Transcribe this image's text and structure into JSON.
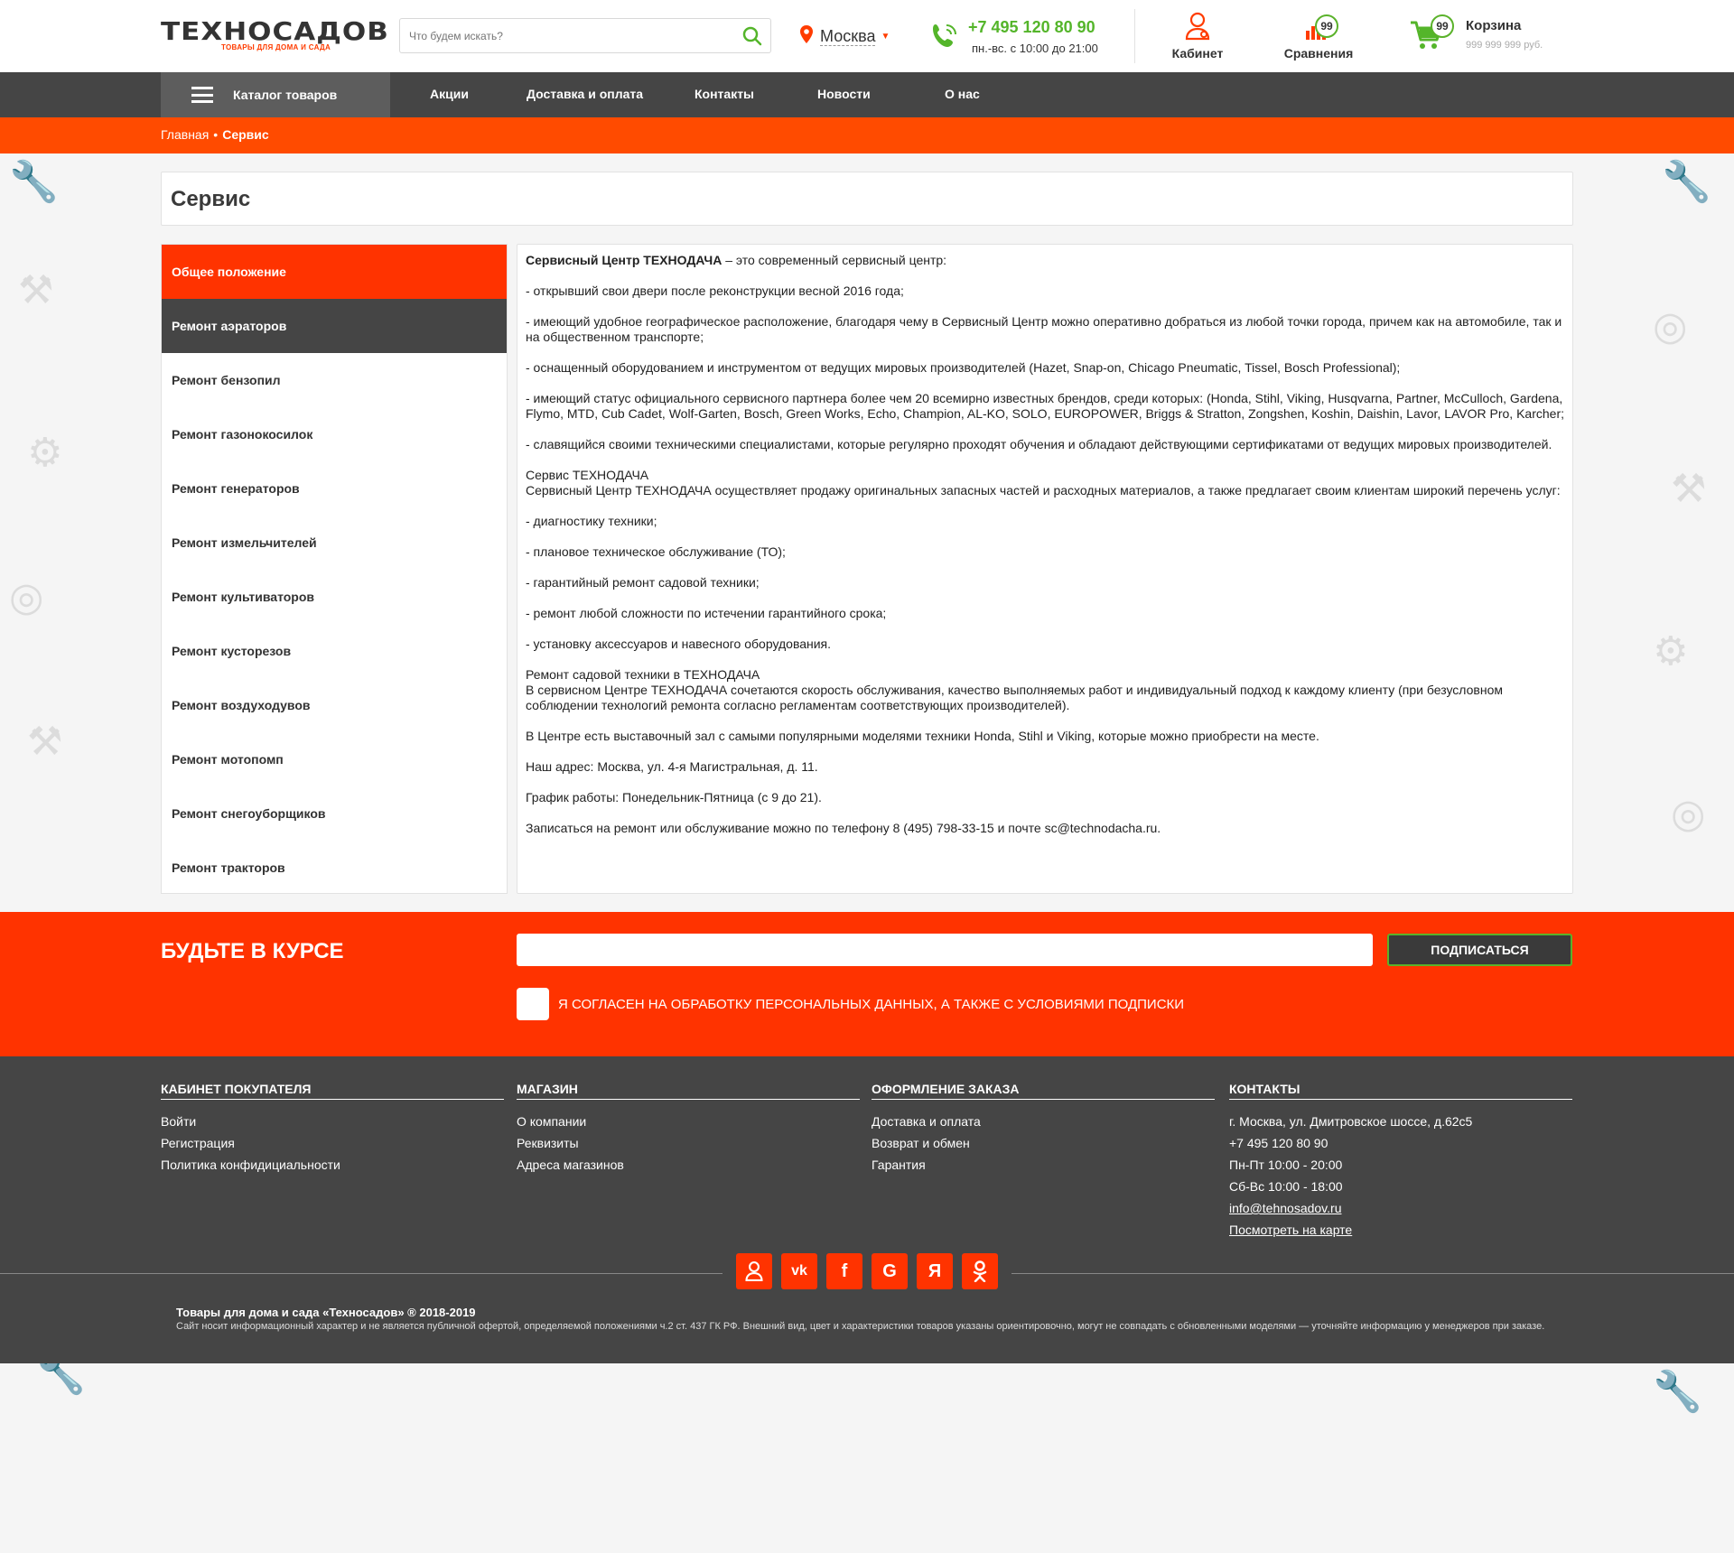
{
  "header": {
    "logo_title": "ТЕХНОСАДОВ",
    "logo_subtitle": "ТОВАРЫ ДЛЯ ДОМА И САДА",
    "search_placeholder": "Что будем искать?",
    "city": "Москва",
    "phone": "+7 495 120 80 90",
    "hours": "пн.-вс. с 10:00 до 21:00",
    "cabinet_label": "Кабинет",
    "compare_label": "Сравнения",
    "compare_count": "99",
    "cart_label": "Корзина",
    "cart_count": "99",
    "cart_sum": "999 999 999 руб."
  },
  "nav": {
    "catalog": "Каталог товаров",
    "items": [
      "Акции",
      "Доставка и оплата",
      "Контакты",
      "Новости",
      "О нас"
    ]
  },
  "breadcrumbs": {
    "home": "Главная",
    "separator": "•",
    "current": "Сервис"
  },
  "page_title": "Сервис",
  "sidebar": {
    "items": [
      "Общее положение",
      "Ремонт аэраторов",
      "Ремонт бензопил",
      "Ремонт газонокосилок",
      "Ремонт генераторов",
      "Ремонт измельчителей",
      "Ремонт культиваторов",
      "Ремонт кусторезов",
      "Ремонт воздуходувов",
      "Ремонт мотопомп",
      "Ремонт снегоуборщиков",
      "Ремонт тракторов"
    ]
  },
  "content": {
    "intro_bold": "Сервисный Центр ТЕХНОДАЧА",
    "intro_rest": " – это современный сервисный центр:",
    "p1": "- открывший свои двери после реконструкции весной 2016 года;",
    "p2": "- имеющий удобное географическое расположение, благодаря чему в Сервисный Центр можно оперативно добраться из любой точки города, причем как на автомобиле, так и на общественном транспорте;",
    "p3": "- оснащенный оборудованием и инструментом от ведущих мировых производителей (Hazet, Snap-on, Chicago Pneumatic, Tissel, Bosch Professional);",
    "p4": "- имеющий статус официального сервисного партнера более чем 20 всемирно известных брендов, среди которых: (Honda, Stihl, Viking, Husqvarna, Partner, McCulloch, Gardena, Flymo, MTD, Cub Cadet, Wolf-Garten, Bosch, Green Works, Echo, Champion, AL-KO, SOLO, EUROPOWER, Briggs & Stratton, Zongshen, Koshin, Daishin, Lavor, LAVOR Pro, Karcher;",
    "p5": "- славящийся своими техническими специалистами, которые регулярно проходят обучения и обладают действующими сертификатами от ведущих мировых производителей.",
    "p6_title": "Сервис ТЕХНОДАЧА",
    "p6": "Сервисный Центр ТЕХНОДАЧА осуществляет продажу оригинальных запасных частей и расходных материалов, а также предлагает своим клиентам широкий перечень услуг:",
    "s1": "- диагностику техники;",
    "s2": "- плановое техническое обслуживание (ТО);",
    "s3": "- гарантийный ремонт садовой техники;",
    "s4": "- ремонт любой сложности по истечении гарантийного срока;",
    "s5": "- установку аксессуаров и навесного оборудования.",
    "p7_title": "Ремонт садовой техники в ТЕХНОДАЧА",
    "p7": "В сервисном Центре ТЕХНОДАЧА сочетаются скорость обслуживания, качество выполняемых работ и индивидуальный подход к каждому клиенту (при безусловном соблюдении технологий ремонта согласно регламентам соответствующих производителей).",
    "p8": "В Центре есть выставочный зал с самыми популярными моделями техники Honda, Stihl и Viking, которые можно приобрести на месте.",
    "p9": "Наш адрес: Москва, ул. 4-я Магистральная, д. 11.",
    "p10": "График работы: Понедельник-Пятница (с 9 до 21).",
    "p11": "Записаться на ремонт или обслуживание можно по телефону 8 (495) 798-33-15 и почте sc@technodacha.ru."
  },
  "subscribe": {
    "title": "БУДЬТЕ В КУРСЕ",
    "email_value": "",
    "button": "ПОДПИСАТЬСЯ",
    "consent": "Я СОГЛАСЕН НА ОБРАБОТКУ ПЕРСОНАЛЬНЫХ ДАННЫХ, А ТАКЖЕ С УСЛОВИЯМИ ПОДПИСКИ"
  },
  "footer": {
    "cabinet": {
      "title": "КАБИНЕТ ПОКУПАТЕЛЯ",
      "links": [
        "Войти",
        "Регистрация",
        "Политика конфидициальности"
      ]
    },
    "shop": {
      "title": "МАГАЗИН",
      "links": [
        "О компании",
        "Реквизиты",
        "Адреса магазинов"
      ]
    },
    "order": {
      "title": "ОФОРМЛЕНИЕ ЗАКАЗА",
      "links": [
        "Доставка и оплата",
        "Возврат и обмен",
        "Гарантия"
      ]
    },
    "contacts": {
      "title": "КОНТАКТЫ",
      "address": "г. Москва, ул. Дмитровское шоссе, д.62с5",
      "phone": "+7 495 120 80 90",
      "weekdays": "Пн-Пт 10:00 - 20:00",
      "weekend": "Сб-Вс 10:00 - 18:00",
      "email": "info@tehnosadov.ru",
      "map": "Посмотреть на карте"
    },
    "social": {
      "vk": "vk",
      "facebook": "f",
      "google": "G",
      "yandex": "Я"
    },
    "copyright_title": "Товары для дома и сада «Техносадов» ® 2018-2019",
    "copyright_text": "Сайт носит информационный характер и не является публичной офертой, определяемой положениями ч.2 ст. 437 ГК РФ. Внешний вид, цвет и характеристики товаров указаны ориентировочно, могут не совпадать с обновленными моделями — уточняйте информацию у менеджеров при заказе."
  },
  "colors": {
    "accent_orange": "#ff3300",
    "green": "#54b52a",
    "dark": "#454545"
  }
}
